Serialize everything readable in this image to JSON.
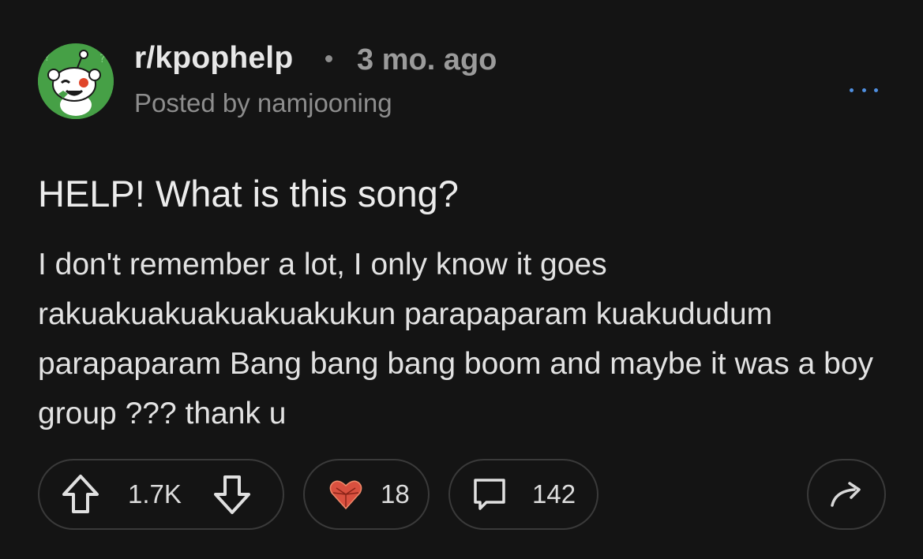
{
  "post": {
    "subreddit": "r/kpophelp",
    "time_ago": "3 mo. ago",
    "posted_by": "Posted by namjooning",
    "title": "HELP! What is this song?",
    "body": "I don't remember a lot, I only know it goes rakuakuakuakuakuakukun parapaparam kuakududum parapaparam Bang bang bang boom and maybe it was a boy group ??? thank u"
  },
  "actions": {
    "vote_count": "1.7K",
    "award_count": "18",
    "comment_count": "142"
  },
  "icons": {
    "avatar": "snoo-avatar-icon",
    "more": "more-options-icon",
    "upvote": "upvote-arrow-icon",
    "downvote": "downvote-arrow-icon",
    "award": "heart-award-icon",
    "comment": "comment-bubble-icon",
    "share": "share-arrow-icon"
  },
  "colors": {
    "background": "#141414",
    "avatar_bg": "#46a046",
    "more_dots": "#4f8fe0",
    "award_red": "#d9503f"
  }
}
